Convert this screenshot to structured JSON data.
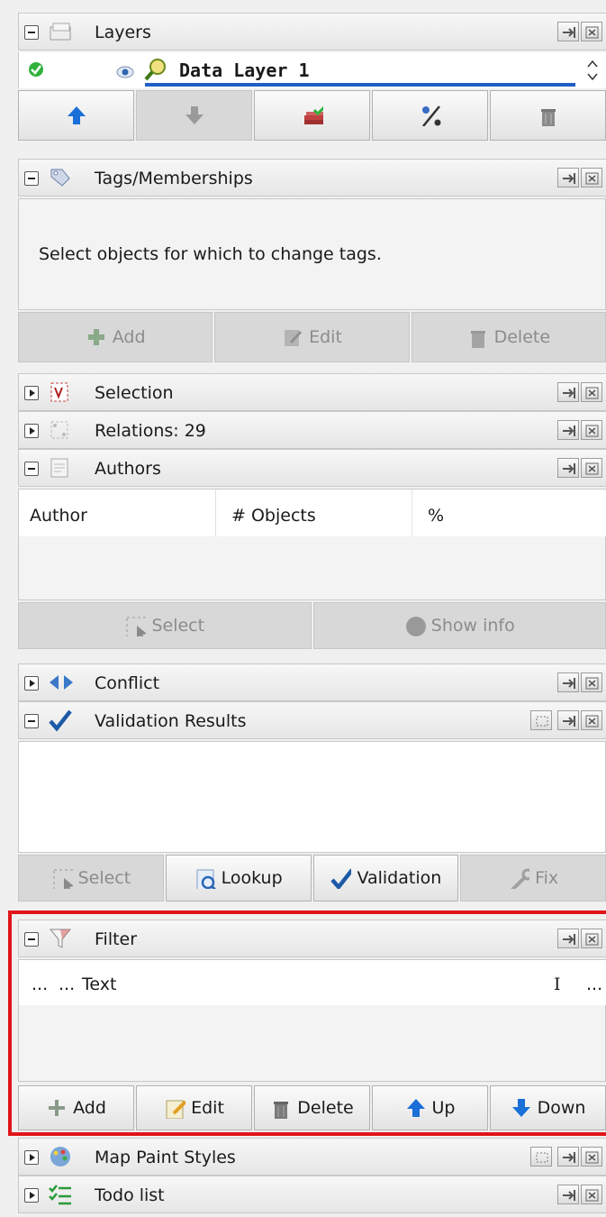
{
  "panels": {
    "layers": {
      "title": "Layers",
      "layer_name": "Data Layer 1"
    },
    "tags": {
      "title": "Tags/Memberships",
      "message": "Select objects for which to change tags.",
      "add": "Add",
      "edit": "Edit",
      "delete": "Delete"
    },
    "selection": {
      "title": "Selection"
    },
    "relations": {
      "title": "Relations: 29"
    },
    "authors": {
      "title": "Authors",
      "columns": [
        "Author",
        "# Objects",
        "%"
      ],
      "select": "Select",
      "show_info": "Show info"
    },
    "conflict": {
      "title": "Conflict"
    },
    "validation": {
      "title": "Validation Results",
      "select": "Select",
      "lookup": "Lookup",
      "validation": "Validation",
      "fix": "Fix"
    },
    "filter": {
      "title": "Filter",
      "col1": "...",
      "col2": "...",
      "col_text": "Text",
      "col_i": "I",
      "col_more": "...",
      "add": "Add",
      "edit": "Edit",
      "delete": "Delete",
      "up": "Up",
      "down": "Down"
    },
    "map_paint": {
      "title": "Map Paint Styles"
    },
    "todo": {
      "title": "Todo list"
    }
  },
  "colors": {
    "highlight_border": "#e0151a",
    "layer_underline": "#1f5fc6",
    "arrow_blue": "#1a6fd8",
    "validation_check": "#1b5aa6"
  }
}
